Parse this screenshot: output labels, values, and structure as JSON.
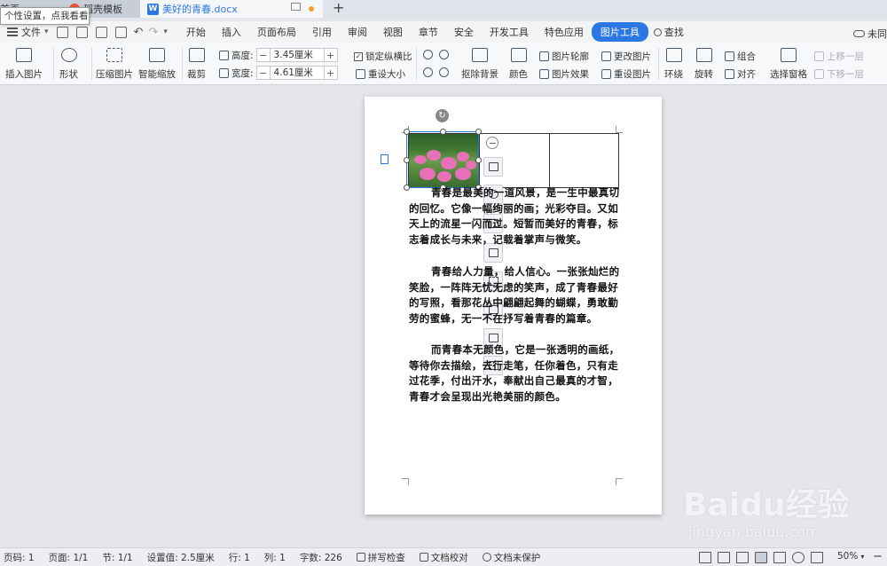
{
  "tooltip": "个性设置，点我看看",
  "tabs": [
    {
      "label": "首页"
    },
    {
      "label": "稻壳模板"
    },
    {
      "label": "美好的青春.docx"
    }
  ],
  "menu": {
    "file": "文件",
    "items": [
      "开始",
      "插入",
      "页面布局",
      "引用",
      "审阅",
      "视图",
      "章节",
      "安全",
      "开发工具",
      "特色应用",
      "图片工具"
    ],
    "active": "图片工具",
    "search": "查找",
    "cloud": "未同"
  },
  "ribbon": {
    "insert_picture": "插入图片",
    "shape": "形状",
    "compress": "压缩图片",
    "smart_scale": "智能缩放",
    "crop": "裁剪",
    "height_label": "高度:",
    "height_value": "3.45厘米",
    "width_label": "宽度:",
    "width_value": "4.61厘米",
    "lock_ratio": "锁定纵横比",
    "reset_size": "重设大小",
    "remove_bg": "抠除背景",
    "color": "颜色",
    "outline": "图片轮廓",
    "effect": "图片效果",
    "change_pic": "更改图片",
    "reset_pic": "重设图片",
    "wrap": "环绕",
    "rotate": "旋转",
    "group": "组合",
    "align": "对齐",
    "select_pane": "选择窗格",
    "bring_forward": "上移一层",
    "send_backward": "下移一层"
  },
  "document": {
    "paragraphs": [
      "青春是最美的一道风景，是一生中最真切的回忆。它像一幅绚丽的画；光彩夺目。又如天上的流星一闪而过。短暂而美好的青春，标志着成长与未来，记载着掌声与微笑。",
      "青春给人力量，给人信心。一张张灿烂的笑脸，一阵阵无忧无虑的笑声，成了青春最好的写照，看那花丛中翩翩起舞的蝴蝶，勇敢勤劳的蜜蜂，无一不在抒写着青春的篇章。",
      "而青春本无颜色，它是一张透明的画纸，等待你去描绘，去行走笔，任你着色，只有走过花季，付出汗水，奉献出自己最真的才智，青春才会呈现出光艳美丽的颜色。"
    ]
  },
  "status": {
    "page_code": "页码: 1",
    "pages": "页面: 1/1",
    "section": "节: 1/1",
    "setting": "设置值: 2.5厘米",
    "row": "行: 1",
    "col": "列: 1",
    "words": "字数: 226",
    "spell": "拼写检查",
    "proof": "文档校对",
    "protect": "文档未保护",
    "zoom": "50%"
  },
  "watermark": {
    "logo": "Baidu经验",
    "url": "jingyan.baidu.com"
  },
  "colors": {
    "accent": "#2b78e4",
    "flower": "#e870b8"
  }
}
